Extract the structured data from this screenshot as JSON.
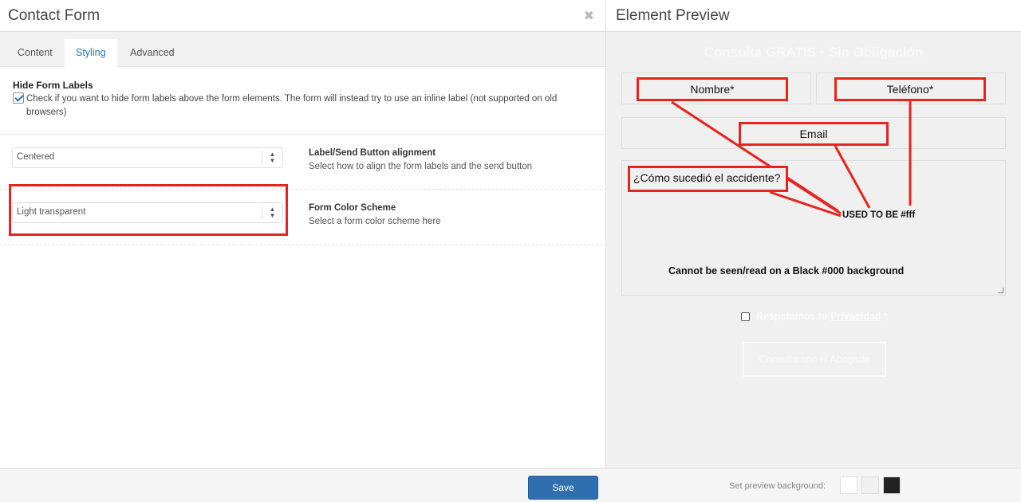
{
  "left_panel": {
    "title": "Contact Form",
    "close_glyph": "✖",
    "tabs": [
      {
        "label": "Content",
        "active": false
      },
      {
        "label": "Styling",
        "active": true
      },
      {
        "label": "Advanced",
        "active": false
      }
    ],
    "hide_labels": {
      "title": "Hide Form Labels",
      "checked": true,
      "description": "Check if you want to hide form labels above the form elements. The form will instead try to use an inline label (not supported on old browsers)"
    },
    "alignment": {
      "value": "Centered",
      "title": "Label/Send Button alignment",
      "description": "Select how to align the form labels and the send button"
    },
    "color_scheme": {
      "value": "Light transparent",
      "title": "Form Color Scheme",
      "description": "Select a form color scheme here"
    },
    "save_label": "Save"
  },
  "right_panel": {
    "title": "Element Preview",
    "form_title": "Consulta GRATIS • Sin Obligación",
    "fields": {
      "nombre": "Nombre*",
      "telefono": "Teléfono*",
      "email": "Email",
      "question": "¿Cómo sucedió el accidente?"
    },
    "annotations": {
      "used_to_be": "USED TO BE #fff",
      "cannot_be_seen": "Cannot be seen/read on a Black #000 background"
    },
    "privacy": {
      "prefix": "Respetamos tu ",
      "link": "Privacidad",
      "suffix": " *"
    },
    "submit_label": "Consulta con el Abogado",
    "preview_bg_label": "Set preview background:",
    "swatches": [
      "#ffffff",
      "#f0f0f0",
      "#222222"
    ]
  }
}
